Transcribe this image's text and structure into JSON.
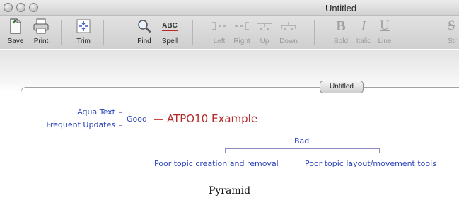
{
  "window": {
    "title": "Untitled"
  },
  "toolbar": {
    "items": [
      {
        "label": "Save",
        "icon": "document-icon"
      },
      {
        "label": "Print",
        "icon": "printer-icon"
      },
      {
        "label": "Trim",
        "icon": "trim-icon"
      },
      {
        "label": "Find",
        "icon": "magnifier-icon"
      },
      {
        "label": "Spell",
        "icon": "spell-check-icon"
      },
      {
        "label": "Left",
        "icon": "move-left-icon"
      },
      {
        "label": "Right",
        "icon": "move-right-icon"
      },
      {
        "label": "Up",
        "icon": "move-up-icon"
      },
      {
        "label": "Down",
        "icon": "move-down-icon"
      },
      {
        "label": "Bold",
        "icon": "bold-icon"
      },
      {
        "label": "Italic",
        "icon": "italic-icon"
      },
      {
        "label": "Line",
        "icon": "underline-icon"
      },
      {
        "label": "Str",
        "icon": "strikethrough-icon"
      }
    ],
    "spell_glyph": "ABC",
    "bold_glyph": "B",
    "italic_glyph": "I",
    "underline_glyph": "U",
    "strike_glyph": "S"
  },
  "document": {
    "tab_label": "Untitled",
    "map": {
      "root": "ATPO10 Example",
      "good": "Good",
      "good_items": [
        "Aqua Text",
        "Frequent Updates"
      ],
      "bad": "Bad",
      "bad_items": [
        "Poor topic creation and removal",
        "Poor topic layout/movement tools"
      ]
    }
  },
  "caption": "Pyramid",
  "colors": {
    "topic_blue": "#2a43b8",
    "root_red": "#b42a2a"
  }
}
